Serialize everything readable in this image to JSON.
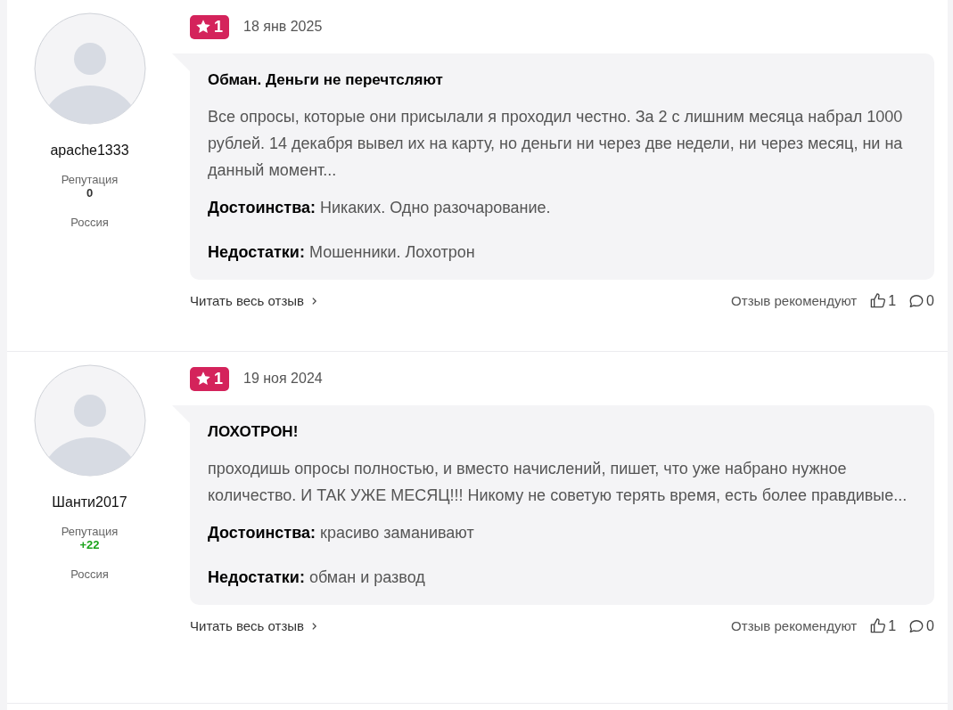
{
  "reviews": [
    {
      "user": {
        "name": "apache1333",
        "reputation_label": "Репутация",
        "reputation": {
          "value": "0",
          "color": "#333333"
        },
        "country": "Россия"
      },
      "rating": "1",
      "date": "18 янв 2025",
      "title": "Обман. Деньги не перечтсляют",
      "text": "Все опросы, которые они присылали я проходил честно. За 2 с лишним месяца набрал 1000 рублей. 14 декабря вывел их на карту, но деньги ни через две недели, ни через месяц, ни на данный момент...",
      "pros_label": "Достоинства:",
      "pros": "Никаких. Одно разочарование.",
      "cons_label": "Недостатки:",
      "cons": "Мошенники. Лохотрон",
      "read_more": "Читать весь отзыв",
      "recommend_label": "Отзыв рекомендуют",
      "likes": "1",
      "comments": "0"
    },
    {
      "user": {
        "name": "Шанти2017",
        "reputation_label": "Репутация",
        "reputation": {
          "value": "+22",
          "color": "#1aa31a"
        },
        "country": "Россия"
      },
      "rating": "1",
      "date": "19 ноя 2024",
      "title": "ЛОХОТРОН!",
      "text": "проходишь опросы полностью, и вместо начислений, пишет, что уже набрано нужное количество. И ТАК УЖЕ МЕСЯЦ!!! Никому не советую терять время, есть более правдивые...",
      "pros_label": "Достоинства:",
      "pros": "красиво заманивают",
      "cons_label": "Недостатки:",
      "cons": "обман и развод",
      "read_more": "Читать весь отзыв",
      "recommend_label": "Отзыв рекомендуют",
      "likes": "1",
      "comments": "0"
    }
  ]
}
